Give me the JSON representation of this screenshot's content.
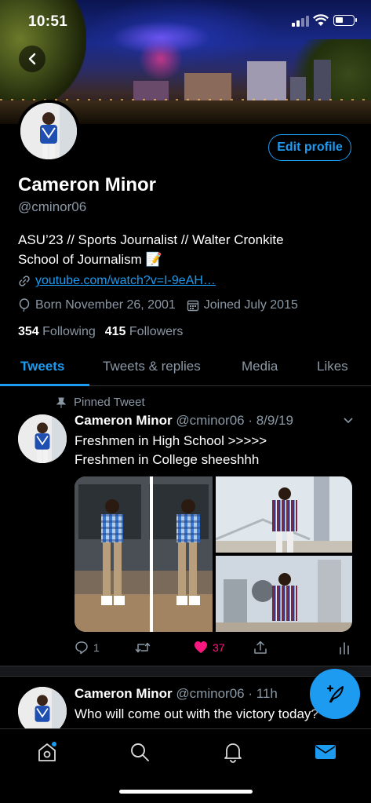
{
  "status_bar": {
    "time": "10:51"
  },
  "profile": {
    "name": "Cameron Minor",
    "handle": "@cminor06",
    "bio_line1": "ASU’23 // Sports Journalist // Walter Cronkite",
    "bio_line2": "School of Journalism 📝",
    "link": "youtube.com/watch?v=I-9eAH…",
    "born": "Born November 26, 2001",
    "joined": "Joined July 2015",
    "following_count": "354",
    "following_label": "Following",
    "followers_count": "415",
    "followers_label": "Followers",
    "edit_label": "Edit profile"
  },
  "tabs": [
    {
      "label": "Tweets"
    },
    {
      "label": "Tweets & replies"
    },
    {
      "label": "Media"
    },
    {
      "label": "Likes"
    }
  ],
  "pinned_tweet": {
    "pinned_label": "Pinned Tweet",
    "name": "Cameron Minor",
    "meta": "@cminor06 · 8/9/19",
    "line1": "Freshmen in High School >>>>>",
    "line2": "Freshmen in College sheeshhh",
    "replies": "1",
    "retweets": "",
    "likes": "37"
  },
  "second_tweet": {
    "name": "Cameron Minor",
    "meta": "@cminor06 · 11h",
    "line1": "Who will come out with the victory today?"
  },
  "colors": {
    "accent": "#1d9bf0",
    "like": "#f91880",
    "muted": "#8b98a5"
  },
  "icons": [
    "back-arrow-icon",
    "link-icon",
    "balloon-icon",
    "calendar-icon",
    "pin-icon",
    "chevron-down-icon",
    "reply-icon",
    "retweet-icon",
    "heart-icon",
    "share-icon",
    "analytics-icon",
    "compose-icon",
    "home-icon",
    "search-icon",
    "bell-icon",
    "mail-icon"
  ]
}
